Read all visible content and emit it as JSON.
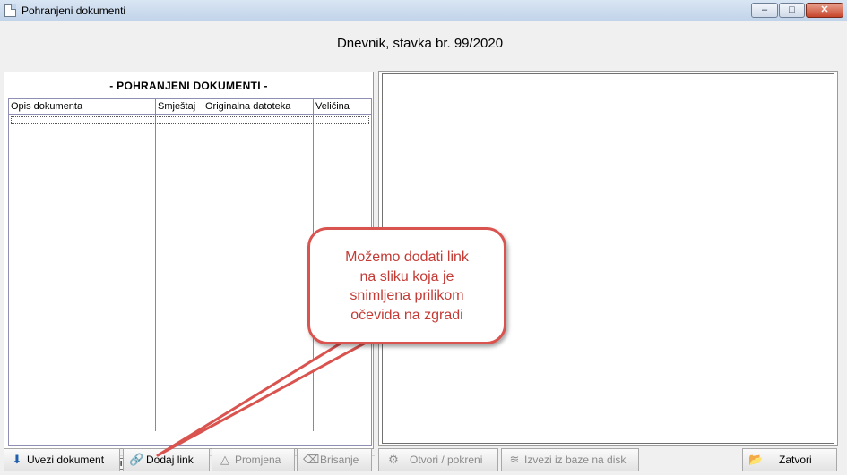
{
  "window": {
    "title": "Pohranjeni dokumenti",
    "controls": {
      "minimize": "–",
      "maximize": "□",
      "close": "✕"
    }
  },
  "heading": "Dnevnik, stavka br. 99/2020",
  "documents_panel": {
    "title": "- POHRANJENI DOKUMENTI -",
    "columns": [
      "Opis dokumenta",
      "Smještaj",
      "Originalna datoteka",
      "Veličina"
    ],
    "rows": [],
    "navigator": [
      "I◀",
      "◀◀",
      "◀",
      "?",
      "▶",
      "▶▶",
      "▶I"
    ],
    "scroll_left": "<",
    "scroll_right": ">"
  },
  "buttons": {
    "import": {
      "label": "Uvezi dokument",
      "icon": "import-arrow-icon",
      "glyph": "⬇"
    },
    "add_link": {
      "label": "Dodaj link",
      "icon": "link-chain-icon",
      "glyph": "🔗"
    },
    "edit": {
      "label": "Promjena",
      "icon": "edit-triangle-icon",
      "glyph": "△"
    },
    "delete": {
      "label": "Brisanje",
      "icon": "eraser-icon",
      "glyph": "⌫"
    },
    "open": {
      "label": "Otvori / pokreni",
      "icon": "gear-icon",
      "glyph": "⚙"
    },
    "export": {
      "label": "Izvezi iz baze na disk",
      "icon": "database-icon",
      "glyph": "≋"
    },
    "close": {
      "label": "Zatvori",
      "icon": "folder-icon",
      "glyph": "📂"
    }
  },
  "callout": {
    "lines": [
      "Možemo dodati link",
      "na sliku koja je",
      "snimljena prilikom",
      "očevida na zgradi"
    ]
  },
  "colors": {
    "callout_border": "#d9534f",
    "callout_text": "#c43b35",
    "titlebar": "#c2d4ea"
  }
}
